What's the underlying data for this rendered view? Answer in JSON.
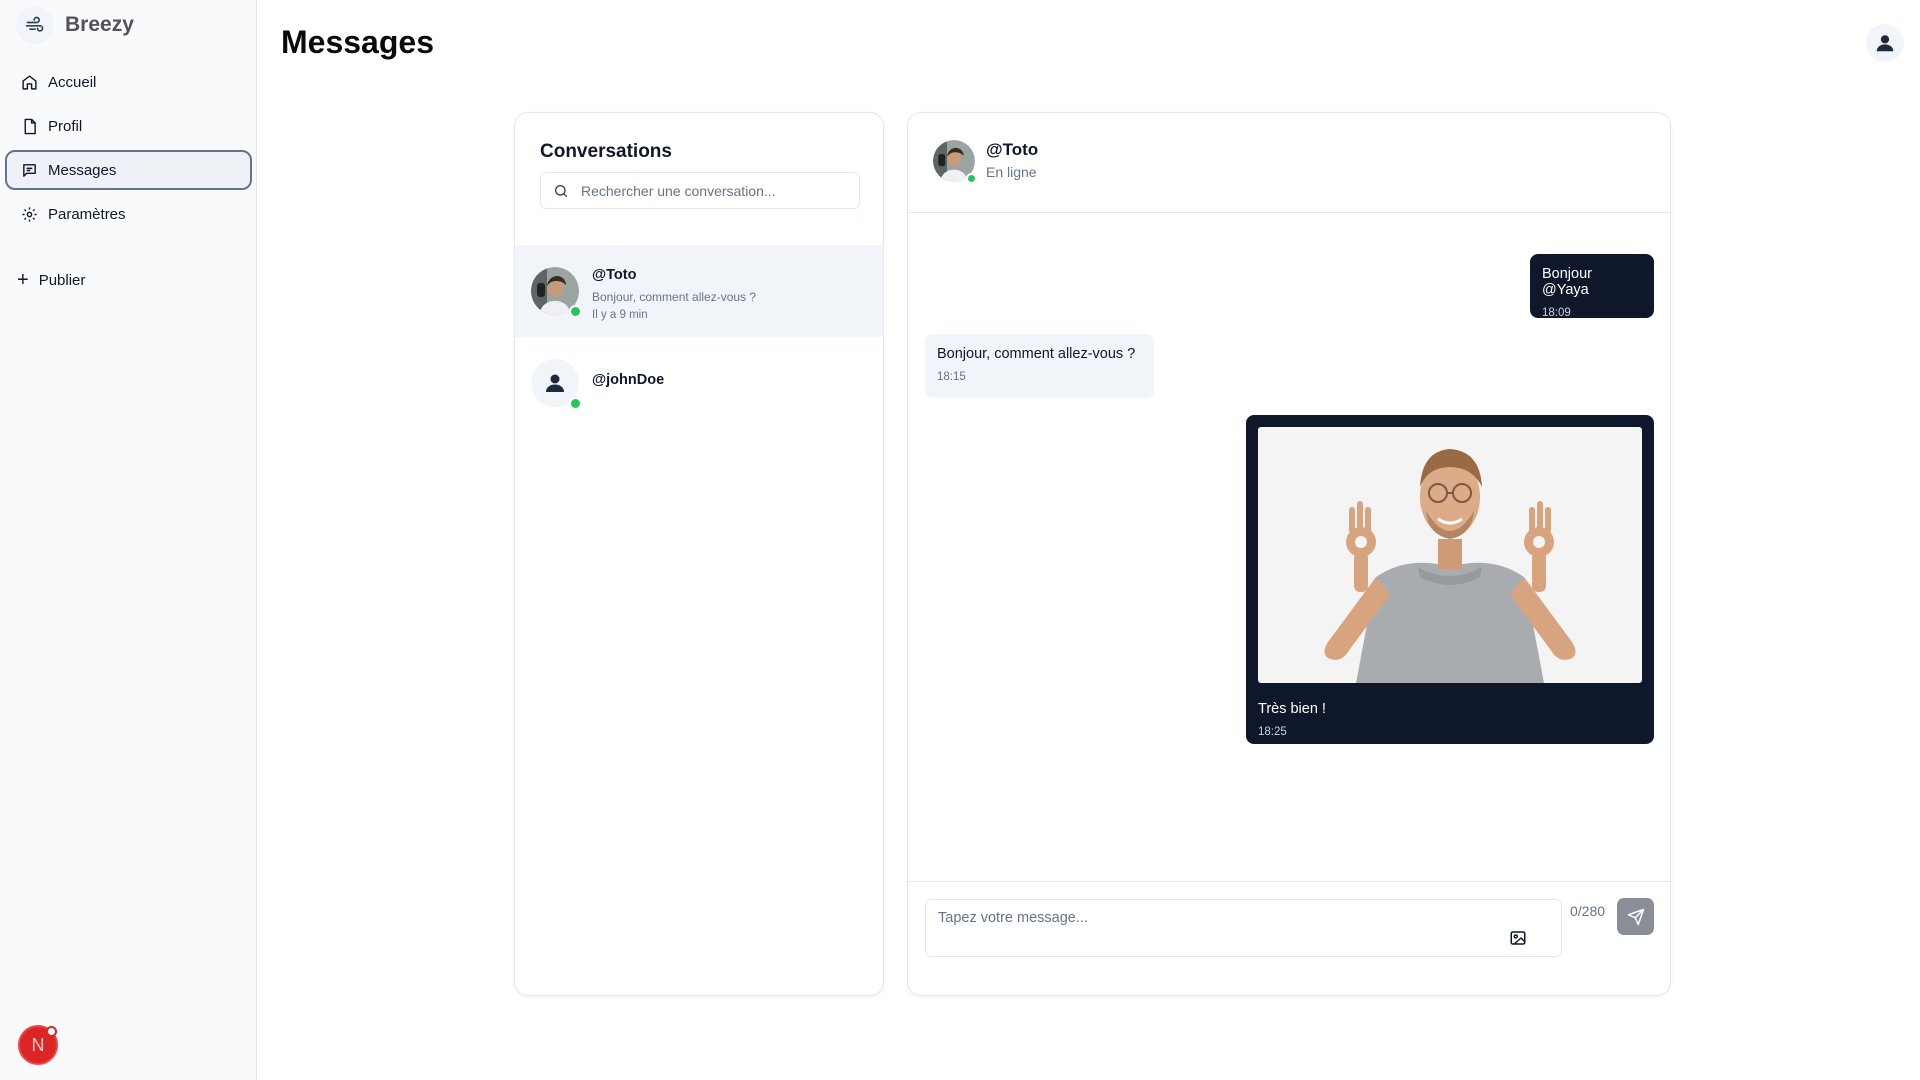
{
  "app": {
    "name": "Breezy"
  },
  "sidebar": {
    "items": [
      {
        "label": "Accueil",
        "icon": "home-icon",
        "active": false
      },
      {
        "label": "Profil",
        "icon": "file-icon",
        "active": false
      },
      {
        "label": "Messages",
        "icon": "message-icon",
        "active": true
      },
      {
        "label": "Paramètres",
        "icon": "gear-icon",
        "active": false
      }
    ],
    "publish_label": "Publier",
    "user_initial": "N"
  },
  "header": {
    "title": "Messages"
  },
  "conversations": {
    "title": "Conversations",
    "search_placeholder": "Rechercher une conversation...",
    "items": [
      {
        "name": "@Toto",
        "preview": "Bonjour, comment allez-vous ?",
        "time": "Il y a 9 min",
        "online": true,
        "selected": true
      },
      {
        "name": "@johnDoe",
        "online": true,
        "selected": false
      }
    ]
  },
  "chat": {
    "name": "@Toto",
    "status": "En ligne",
    "messages": [
      {
        "direction": "sent",
        "text": "Bonjour @Yaya",
        "time": "18:09"
      },
      {
        "direction": "received",
        "text": "Bonjour, comment allez-vous ?",
        "time": "18:15"
      },
      {
        "direction": "sent",
        "text": "Très bien !",
        "time": "18:25",
        "has_image": true
      }
    ],
    "composer_placeholder": "Tapez votre message...",
    "char_count": "0/280"
  },
  "colors": {
    "accent": "#0f172a",
    "online": "#22c55e",
    "user_badge": "#dc2626",
    "selected_bg": "#f1f5f9"
  }
}
